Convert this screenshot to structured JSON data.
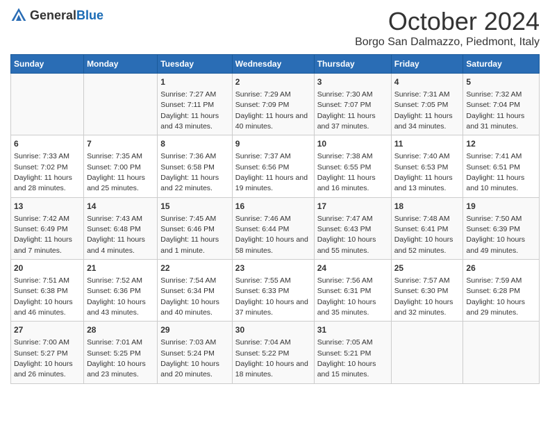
{
  "header": {
    "logo_general": "General",
    "logo_blue": "Blue",
    "month_title": "October 2024",
    "location": "Borgo San Dalmazzo, Piedmont, Italy"
  },
  "weekdays": [
    "Sunday",
    "Monday",
    "Tuesday",
    "Wednesday",
    "Thursday",
    "Friday",
    "Saturday"
  ],
  "weeks": [
    [
      {
        "day": "",
        "sunrise": "",
        "sunset": "",
        "daylight": ""
      },
      {
        "day": "",
        "sunrise": "",
        "sunset": "",
        "daylight": ""
      },
      {
        "day": "1",
        "sunrise": "Sunrise: 7:27 AM",
        "sunset": "Sunset: 7:11 PM",
        "daylight": "Daylight: 11 hours and 43 minutes."
      },
      {
        "day": "2",
        "sunrise": "Sunrise: 7:29 AM",
        "sunset": "Sunset: 7:09 PM",
        "daylight": "Daylight: 11 hours and 40 minutes."
      },
      {
        "day": "3",
        "sunrise": "Sunrise: 7:30 AM",
        "sunset": "Sunset: 7:07 PM",
        "daylight": "Daylight: 11 hours and 37 minutes."
      },
      {
        "day": "4",
        "sunrise": "Sunrise: 7:31 AM",
        "sunset": "Sunset: 7:05 PM",
        "daylight": "Daylight: 11 hours and 34 minutes."
      },
      {
        "day": "5",
        "sunrise": "Sunrise: 7:32 AM",
        "sunset": "Sunset: 7:04 PM",
        "daylight": "Daylight: 11 hours and 31 minutes."
      }
    ],
    [
      {
        "day": "6",
        "sunrise": "Sunrise: 7:33 AM",
        "sunset": "Sunset: 7:02 PM",
        "daylight": "Daylight: 11 hours and 28 minutes."
      },
      {
        "day": "7",
        "sunrise": "Sunrise: 7:35 AM",
        "sunset": "Sunset: 7:00 PM",
        "daylight": "Daylight: 11 hours and 25 minutes."
      },
      {
        "day": "8",
        "sunrise": "Sunrise: 7:36 AM",
        "sunset": "Sunset: 6:58 PM",
        "daylight": "Daylight: 11 hours and 22 minutes."
      },
      {
        "day": "9",
        "sunrise": "Sunrise: 7:37 AM",
        "sunset": "Sunset: 6:56 PM",
        "daylight": "Daylight: 11 hours and 19 minutes."
      },
      {
        "day": "10",
        "sunrise": "Sunrise: 7:38 AM",
        "sunset": "Sunset: 6:55 PM",
        "daylight": "Daylight: 11 hours and 16 minutes."
      },
      {
        "day": "11",
        "sunrise": "Sunrise: 7:40 AM",
        "sunset": "Sunset: 6:53 PM",
        "daylight": "Daylight: 11 hours and 13 minutes."
      },
      {
        "day": "12",
        "sunrise": "Sunrise: 7:41 AM",
        "sunset": "Sunset: 6:51 PM",
        "daylight": "Daylight: 11 hours and 10 minutes."
      }
    ],
    [
      {
        "day": "13",
        "sunrise": "Sunrise: 7:42 AM",
        "sunset": "Sunset: 6:49 PM",
        "daylight": "Daylight: 11 hours and 7 minutes."
      },
      {
        "day": "14",
        "sunrise": "Sunrise: 7:43 AM",
        "sunset": "Sunset: 6:48 PM",
        "daylight": "Daylight: 11 hours and 4 minutes."
      },
      {
        "day": "15",
        "sunrise": "Sunrise: 7:45 AM",
        "sunset": "Sunset: 6:46 PM",
        "daylight": "Daylight: 11 hours and 1 minute."
      },
      {
        "day": "16",
        "sunrise": "Sunrise: 7:46 AM",
        "sunset": "Sunset: 6:44 PM",
        "daylight": "Daylight: 10 hours and 58 minutes."
      },
      {
        "day": "17",
        "sunrise": "Sunrise: 7:47 AM",
        "sunset": "Sunset: 6:43 PM",
        "daylight": "Daylight: 10 hours and 55 minutes."
      },
      {
        "day": "18",
        "sunrise": "Sunrise: 7:48 AM",
        "sunset": "Sunset: 6:41 PM",
        "daylight": "Daylight: 10 hours and 52 minutes."
      },
      {
        "day": "19",
        "sunrise": "Sunrise: 7:50 AM",
        "sunset": "Sunset: 6:39 PM",
        "daylight": "Daylight: 10 hours and 49 minutes."
      }
    ],
    [
      {
        "day": "20",
        "sunrise": "Sunrise: 7:51 AM",
        "sunset": "Sunset: 6:38 PM",
        "daylight": "Daylight: 10 hours and 46 minutes."
      },
      {
        "day": "21",
        "sunrise": "Sunrise: 7:52 AM",
        "sunset": "Sunset: 6:36 PM",
        "daylight": "Daylight: 10 hours and 43 minutes."
      },
      {
        "day": "22",
        "sunrise": "Sunrise: 7:54 AM",
        "sunset": "Sunset: 6:34 PM",
        "daylight": "Daylight: 10 hours and 40 minutes."
      },
      {
        "day": "23",
        "sunrise": "Sunrise: 7:55 AM",
        "sunset": "Sunset: 6:33 PM",
        "daylight": "Daylight: 10 hours and 37 minutes."
      },
      {
        "day": "24",
        "sunrise": "Sunrise: 7:56 AM",
        "sunset": "Sunset: 6:31 PM",
        "daylight": "Daylight: 10 hours and 35 minutes."
      },
      {
        "day": "25",
        "sunrise": "Sunrise: 7:57 AM",
        "sunset": "Sunset: 6:30 PM",
        "daylight": "Daylight: 10 hours and 32 minutes."
      },
      {
        "day": "26",
        "sunrise": "Sunrise: 7:59 AM",
        "sunset": "Sunset: 6:28 PM",
        "daylight": "Daylight: 10 hours and 29 minutes."
      }
    ],
    [
      {
        "day": "27",
        "sunrise": "Sunrise: 7:00 AM",
        "sunset": "Sunset: 5:27 PM",
        "daylight": "Daylight: 10 hours and 26 minutes."
      },
      {
        "day": "28",
        "sunrise": "Sunrise: 7:01 AM",
        "sunset": "Sunset: 5:25 PM",
        "daylight": "Daylight: 10 hours and 23 minutes."
      },
      {
        "day": "29",
        "sunrise": "Sunrise: 7:03 AM",
        "sunset": "Sunset: 5:24 PM",
        "daylight": "Daylight: 10 hours and 20 minutes."
      },
      {
        "day": "30",
        "sunrise": "Sunrise: 7:04 AM",
        "sunset": "Sunset: 5:22 PM",
        "daylight": "Daylight: 10 hours and 18 minutes."
      },
      {
        "day": "31",
        "sunrise": "Sunrise: 7:05 AM",
        "sunset": "Sunset: 5:21 PM",
        "daylight": "Daylight: 10 hours and 15 minutes."
      },
      {
        "day": "",
        "sunrise": "",
        "sunset": "",
        "daylight": ""
      },
      {
        "day": "",
        "sunrise": "",
        "sunset": "",
        "daylight": ""
      }
    ]
  ]
}
